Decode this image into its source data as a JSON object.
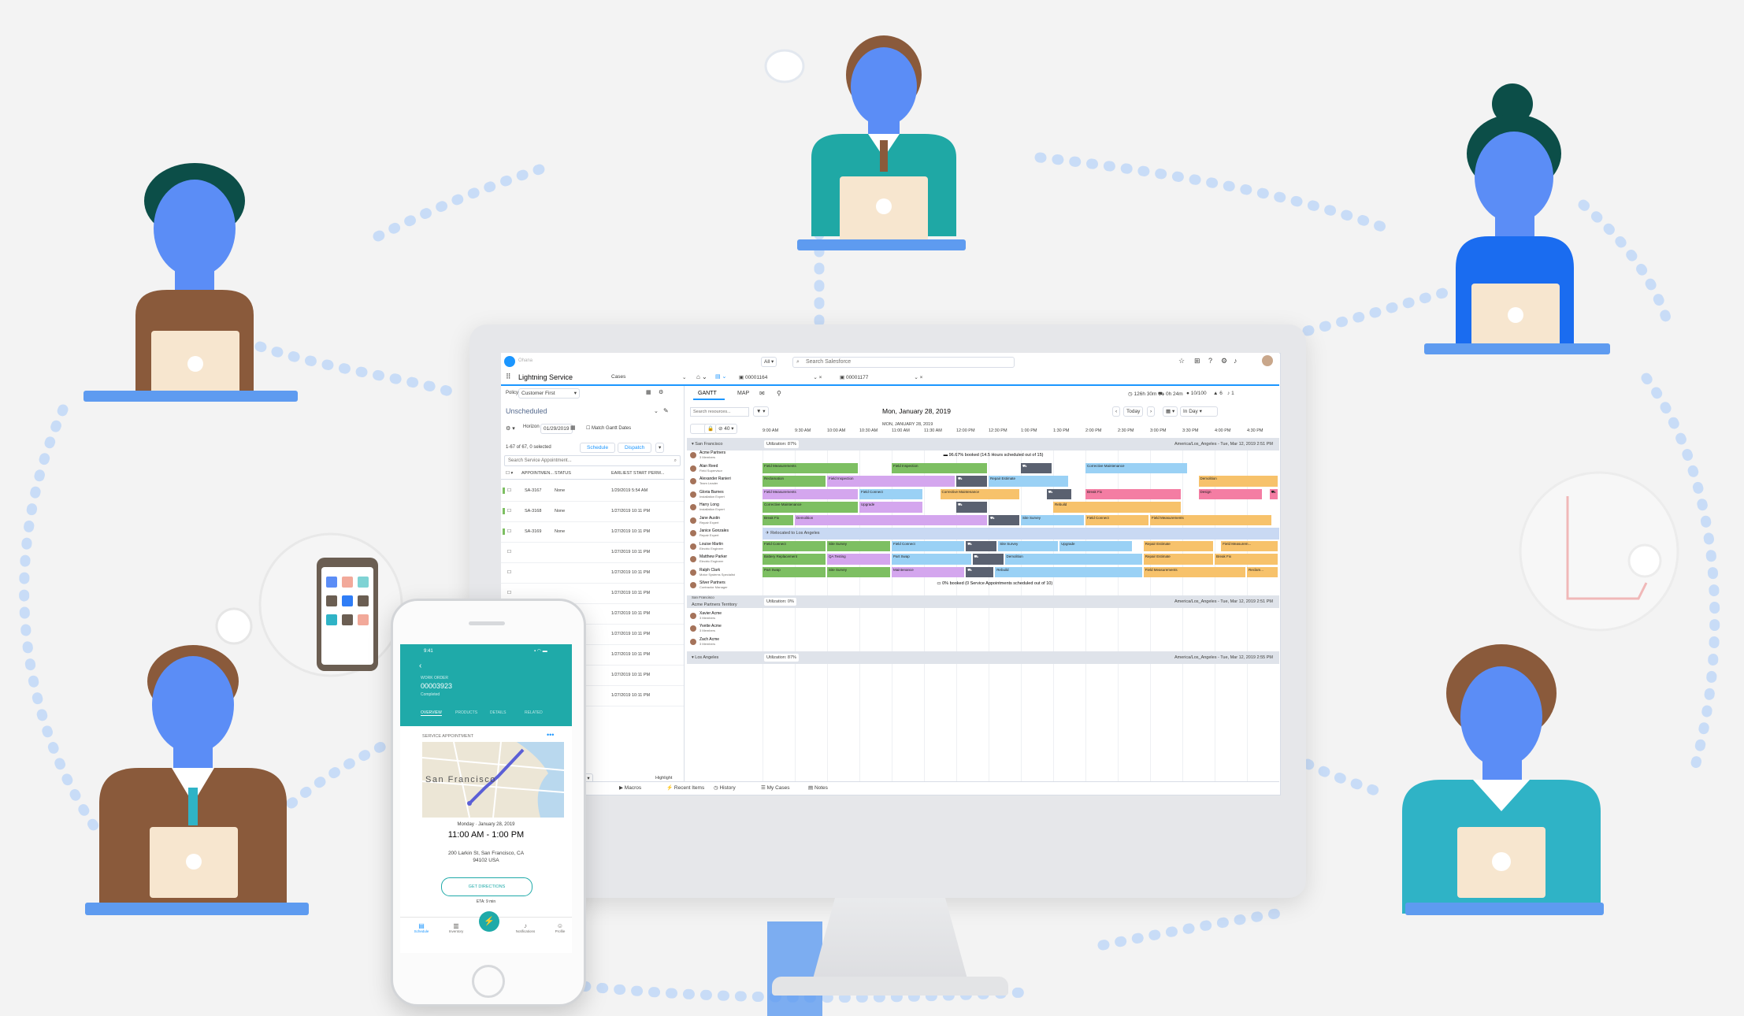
{
  "colors": {
    "accent": "#1b96ff",
    "teal": "#1faaa9",
    "skin": "#5b8df6",
    "bar_green": "#7dbf62",
    "bar_purple": "#d4a6ee",
    "bar_blue": "#9ad1f5",
    "bar_yellow": "#f7c26b",
    "bar_pink": "#f47da3",
    "bar_dark": "#5a6170"
  },
  "app": {
    "logo_label": "Ohana",
    "search_scope": "All",
    "search_placeholder": "Search Salesforce",
    "app_name": "Lightning Service",
    "nav_object": "Cases",
    "tab1": "00001164",
    "tab2": "00001177",
    "policy_label": "Policy",
    "policy_value": "Customer First",
    "unscheduled": "Unscheduled",
    "horizon_label": "Horizon",
    "horizon_date": "01/29/2019",
    "match_gantt": "Match Gantt Dates",
    "selected_count": "1-67 of 67, 0 selected",
    "schedule_btn": "Schedule",
    "dispatch_btn": "Dispatch",
    "search_sa": "Search Service Appointment...",
    "col_appointment": "APPOINTMEN...",
    "col_status": "STATUS",
    "col_earliest": "EARLIEST START PERM...",
    "rows": [
      {
        "id": "SA-3167",
        "status": "None",
        "date": "1/29/2019 5:54 AM"
      },
      {
        "id": "SA-3168",
        "status": "None",
        "date": "1/27/2019 10:11 PM"
      },
      {
        "id": "SA-3169",
        "status": "None",
        "date": "1/27/2019 10:11 PM"
      },
      {
        "id": "",
        "status": "",
        "date": "1/27/2019 10:11 PM"
      },
      {
        "id": "",
        "status": "",
        "date": "1/27/2019 10:11 PM"
      },
      {
        "id": "",
        "status": "",
        "date": "1/27/2019 10:11 PM"
      },
      {
        "id": "",
        "status": "",
        "date": "1/27/2019 10:11 PM"
      },
      {
        "id": "",
        "status": "",
        "date": "1/27/2019 10:11 PM"
      },
      {
        "id": "",
        "status": "",
        "date": "1/27/2019 10:11 PM"
      },
      {
        "id": "",
        "status": "",
        "date": "1/27/2019 10:11 PM"
      },
      {
        "id": "",
        "status": "",
        "date": "1/27/2019 10:11 PM"
      }
    ],
    "page_num": "1",
    "highlight": "Highlight",
    "tab_gantt": "GANTT",
    "tab_map": "MAP",
    "stats": {
      "travel": "126h 30m",
      "drive": "0h 24m",
      "kpi": "10/100",
      "warn": "6",
      "bell": "1"
    },
    "search_resources": "Search resources...",
    "date_title": "Mon, January 28, 2019",
    "today_btn": "Today",
    "view": "In Day",
    "header_date": "MON, JANUARY 28, 2019",
    "zoom": "40",
    "times": [
      "9:00 AM",
      "9:30 AM",
      "10:00 AM",
      "10:30 AM",
      "11:00 AM",
      "11:30 AM",
      "12:00 PM",
      "12:30 PM",
      "1:00 PM",
      "1:30 PM",
      "2:00 PM",
      "2:30 PM",
      "3:00 PM",
      "3:30 PM",
      "4:00 PM",
      "4:30 PM"
    ],
    "territory1": "San Francisco",
    "util1": "Utilization: 87%",
    "tz1": "America/Los_Angeles - Tue, Mar 12, 2019 2:51 PM",
    "booked1": "96.67% booked (14.5 Hours scheduled out of 15)",
    "relocated": "Relocated to Los Angeles",
    "booked2": "0% booked (0 Service Appointments scheduled out of 10)",
    "territory2_small": "San Francisco",
    "territory2": "Acme Partners Territory",
    "util2": "Utilization: 0%",
    "tz2": "America/Los_Angeles - Tue, Mar 12, 2019 2:51 PM",
    "territory3": "Los Angeles",
    "util3": "Utilization: 87%",
    "tz3": "America/Los_Angeles - Tue, Mar 12, 2019 2:55 PM",
    "resources": [
      {
        "name": "Acme Partners",
        "role": "3 Members"
      },
      {
        "name": "Alan Reed",
        "role": "Field Supervisor"
      },
      {
        "name": "Alexander Ranieri",
        "role": "Team Leader"
      },
      {
        "name": "Gloria Barnes",
        "role": "Installation Expert"
      },
      {
        "name": "Harry Long",
        "role": "Installation Expert"
      },
      {
        "name": "Jane Austin",
        "role": "Repair Expert"
      },
      {
        "name": "Janice Gonzales",
        "role": "Repair Expert"
      },
      {
        "name": "Louise Martin",
        "role": "Electric Engineer"
      },
      {
        "name": "Matthew Parker",
        "role": "Electric Engineer"
      },
      {
        "name": "Ralph Clark",
        "role": "Motor Systems Specialist"
      },
      {
        "name": "Silver Partners",
        "role": "Contractor Manager"
      }
    ],
    "resources2": [
      {
        "name": "Xavier Acme",
        "role": "3 Members"
      },
      {
        "name": "Yvette Acme",
        "role": "3 Members"
      },
      {
        "name": "Zach Acme",
        "role": "3 Members"
      }
    ],
    "bar_labels": {
      "field_measurements": "Field Measurements",
      "field_inspection": "Field Inspection",
      "corrective_maintenance": "Corrective Maintenance",
      "reclamation": "Reclamation",
      "repair_estimate": "Repair Estimate",
      "demolition": "Demolition",
      "field_connect": "Field Connect",
      "break_fix": "Break Fix",
      "design": "Design",
      "upgrade": "Upgrade",
      "rebuild": "Rebuild",
      "site_survey": "Site Survey",
      "battery_replacement": "Battery Replacement",
      "qa_testing": "QA Testing",
      "part_swap": "Part Swap",
      "maintenance": "Maintenance",
      "field_measurem_trunc": "Field Measurem...",
      "reclam_trunc": "Reclam..."
    },
    "footer": [
      "Macros",
      "Recent Items",
      "History",
      "My Cases",
      "Notes"
    ]
  },
  "phone": {
    "time": "9:41",
    "label": "WORK ORDER",
    "number": "00003923",
    "status": "Completed",
    "tabs": [
      "OVERVIEW",
      "PRODUCTS",
      "DETAILS",
      "RELATED"
    ],
    "section": "SERVICE APPOINTMENT",
    "city": "San Francisco",
    "date": "Monday · January 28, 2019",
    "time_range": "11:00 AM - 1:00 PM",
    "address1": "200 Larkin St, San Francisco, CA",
    "address2": "94102 USA",
    "directions": "GET DIRECTIONS",
    "eta": "ETA: 9 min",
    "bottom_nav": [
      "Schedule",
      "Inventory",
      "",
      "Notifications",
      "Profile"
    ]
  }
}
